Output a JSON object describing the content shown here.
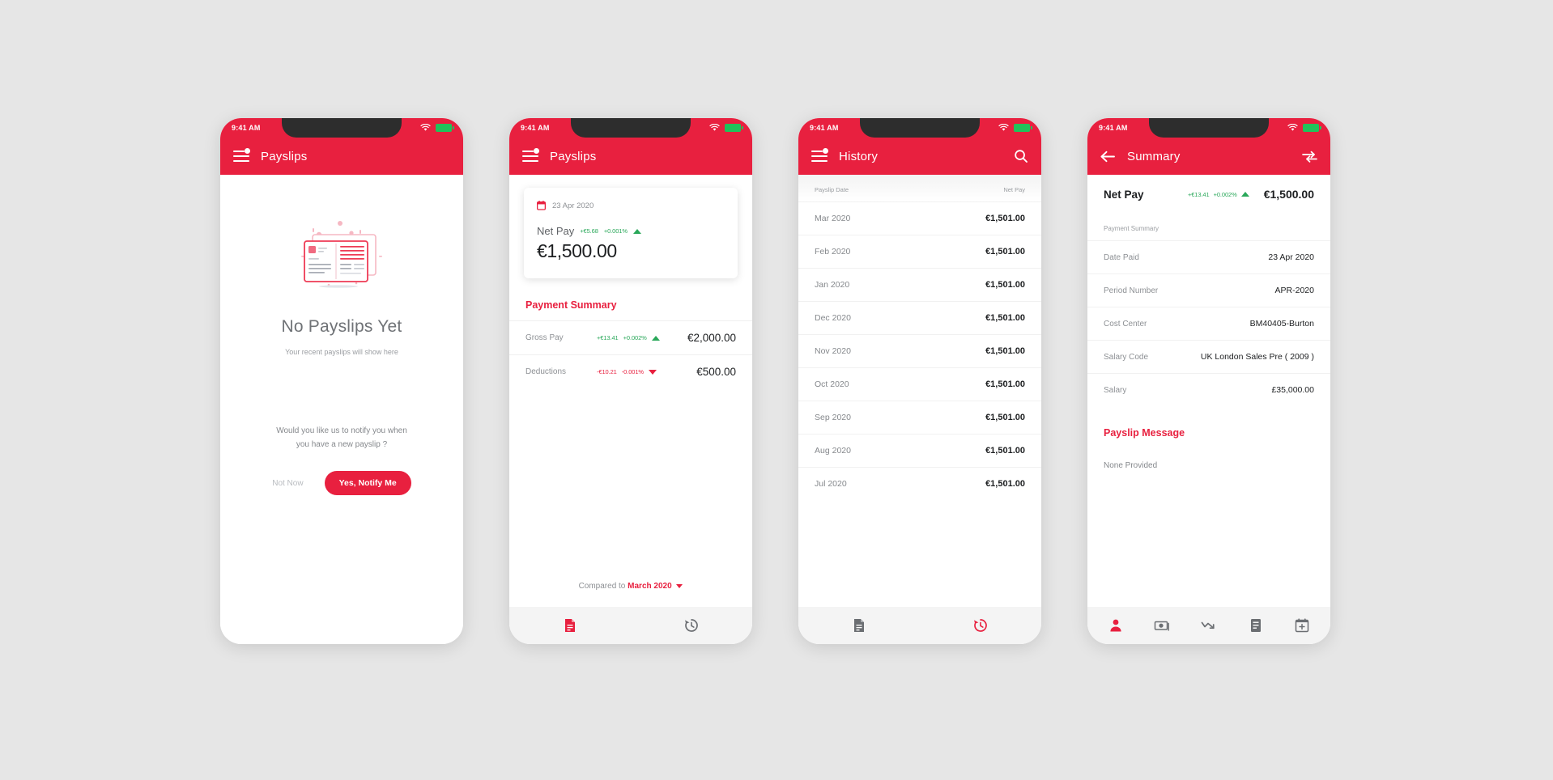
{
  "statusbar": {
    "time": "9:41 AM",
    "wifi_icon": "wifi-icon",
    "battery_icon": "battery-icon"
  },
  "brand": {
    "red": "#e8203f",
    "green": "#2aa85a",
    "grey_bg": "#e6e6e6"
  },
  "screen_empty": {
    "appbar": {
      "menu_icon": "hamburger-menu-icon",
      "title": "Payslips"
    },
    "illustration": "payslip-documents-illustration",
    "title": "No Payslips Yet",
    "subtitle": "Your recent payslips will show here",
    "notify_question": "Would you like us to notify you when you have a new payslip ?",
    "notify_line1": "Would you like us to notify you when",
    "notify_line2": "you have a new payslip ?",
    "btn_secondary": "Not Now",
    "btn_primary": "Yes, Notify Me"
  },
  "screen_payslip": {
    "appbar": {
      "menu_icon": "hamburger-menu-icon",
      "title": "Payslips"
    },
    "card": {
      "calendar_icon": "calendar-icon",
      "date": "23 Apr 2020",
      "net_pay_label": "Net Pay",
      "delta_amount": "+€5.68",
      "delta_percent": "+0.001%",
      "delta_direction": "up",
      "amount": "€1,500.00"
    },
    "section_title": "Payment Summary",
    "rows": [
      {
        "label": "Gross Pay",
        "delta_amount": "+€13.41",
        "delta_percent": "+0.002%",
        "delta_direction": "up",
        "value": "€2,000.00"
      },
      {
        "label": "Deductions",
        "delta_amount": "-€10.21",
        "delta_percent": "-0.001%",
        "delta_direction": "down",
        "value": "€500.00"
      }
    ],
    "compare_prefix": "Compared to",
    "compare_month": "March 2020",
    "compare_caret": "chevron-down-icon",
    "bottom_nav": [
      {
        "icon": "document-icon",
        "active": true
      },
      {
        "icon": "history-icon",
        "active": false
      }
    ]
  },
  "screen_history": {
    "appbar": {
      "menu_icon": "hamburger-menu-icon",
      "title": "History",
      "search_icon": "search-icon"
    },
    "col_date": "Payslip Date",
    "col_netpay": "Net Pay",
    "rows": [
      {
        "period": "Mar 2020",
        "amount": "€1,501.00"
      },
      {
        "period": "Feb 2020",
        "amount": "€1,501.00"
      },
      {
        "period": "Jan 2020",
        "amount": "€1,501.00"
      },
      {
        "period": "Dec 2020",
        "amount": "€1,501.00"
      },
      {
        "period": "Nov 2020",
        "amount": "€1,501.00"
      },
      {
        "period": "Oct 2020",
        "amount": "€1,501.00"
      },
      {
        "period": "Sep 2020",
        "amount": "€1,501.00"
      },
      {
        "period": "Aug 2020",
        "amount": "€1,501.00"
      },
      {
        "period": "Jul 2020",
        "amount": "€1,501.00"
      }
    ],
    "bottom_nav": [
      {
        "icon": "document-icon",
        "active": false
      },
      {
        "icon": "history-icon",
        "active": true
      }
    ]
  },
  "screen_summary": {
    "appbar": {
      "back_icon": "back-arrow-icon",
      "title": "Summary",
      "compare_icon": "compare-transfer-icon"
    },
    "net_pay_label": "Net Pay",
    "net_pay_delta_amount": "+€13.41",
    "net_pay_delta_percent": "+0.002%",
    "net_pay_delta_direction": "up",
    "net_pay_value": "€1,500.00",
    "section_title": "Payment Summary",
    "details": [
      {
        "key": "Date Paid",
        "value": "23 Apr 2020"
      },
      {
        "key": "Period Number",
        "value": "APR-2020"
      },
      {
        "key": "Cost Center",
        "value": "BM40405-Burton"
      },
      {
        "key": "Salary Code",
        "value": "UK London Sales Pre ( 2009 )"
      },
      {
        "key": "Salary",
        "value": "£35,000.00"
      }
    ],
    "message_title": "Payslip Message",
    "message_body": "None Provided",
    "bottom_nav": [
      {
        "icon": "person-icon",
        "active": true
      },
      {
        "icon": "cash-icon",
        "active": false
      },
      {
        "icon": "trend-down-icon",
        "active": false
      },
      {
        "icon": "document-lines-icon",
        "active": false
      },
      {
        "icon": "calendar-add-icon",
        "active": false
      }
    ]
  }
}
